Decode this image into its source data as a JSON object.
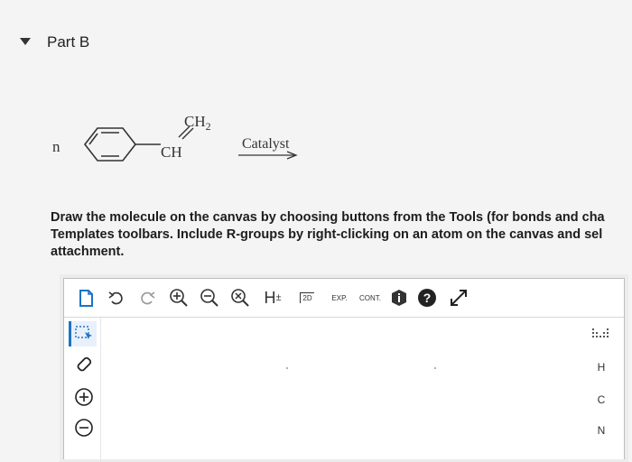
{
  "part": {
    "title": "Part B"
  },
  "reaction": {
    "coefficient": "n",
    "substituent_top": "CH2",
    "substituent_ch": "CH",
    "arrow_label": "Catalyst"
  },
  "instructions": {
    "line1": "Draw the molecule on the canvas by choosing buttons from the Tools (for bonds and cha",
    "line2": "Templates toolbars. Include R-groups by right-clicking on an atom on the canvas and sel",
    "line3": "attachment."
  },
  "toolbar": {
    "h_label": "H",
    "h_sup": "±",
    "twod_label": "2D",
    "exp_label": "EXP.",
    "cont_label": "CONT."
  },
  "elements": [
    "H",
    "C",
    "N"
  ],
  "colors": {
    "accent": "#1a74c4",
    "toolbar_icon": "#333333"
  }
}
